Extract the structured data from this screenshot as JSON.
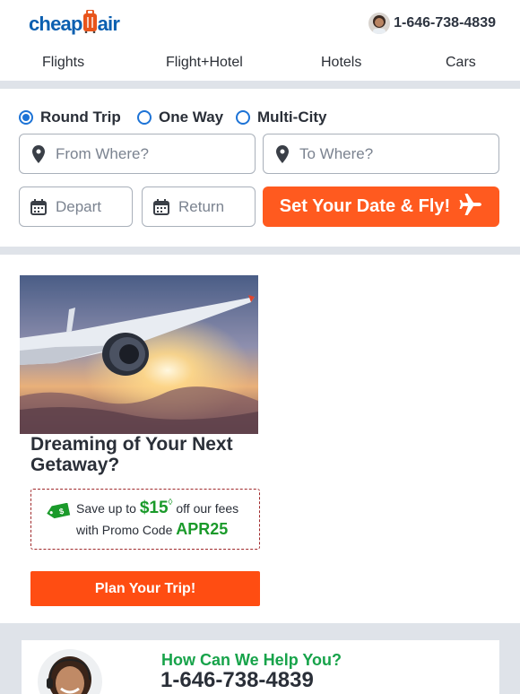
{
  "header": {
    "logo_text_left": "cheap",
    "logo_text_right": "air",
    "phone": "1-646-738-4839"
  },
  "nav": {
    "items": [
      "Flights",
      "Flight+Hotel",
      "Hotels",
      "Cars"
    ]
  },
  "search": {
    "trip_types": [
      "Round Trip",
      "One Way",
      "Multi-City"
    ],
    "selected_trip_type": "Round Trip",
    "from_placeholder": "From Where?",
    "to_placeholder": "To Where?",
    "depart_placeholder": "Depart",
    "return_placeholder": "Return",
    "cta_label": "Set Your Date & Fly!"
  },
  "promo": {
    "headline": "Dreaming of Your Next Getaway?",
    "line1_prefix": "Save up to",
    "amount": "$15",
    "amount_mark": "◊",
    "line1_suffix": "off our fees",
    "line2_prefix": "with Promo Code",
    "code": "APR25",
    "tag_text": "$",
    "button_label": "Plan Your Trip!"
  },
  "help": {
    "question": "How Can We Help You?",
    "phone": "1-646-738-4839"
  },
  "colors": {
    "brand_blue": "#0b5fb0",
    "cta_orange": "#ff5a1f",
    "promo_green": "#1a9a2a",
    "help_green": "#17a34a",
    "band_gray": "#dfe3e9"
  },
  "icons": {
    "logo": "luggage-icon",
    "location": "map-pin-icon",
    "calendar": "calendar-icon",
    "plane": "airplane-icon",
    "tag": "price-tag-icon"
  }
}
